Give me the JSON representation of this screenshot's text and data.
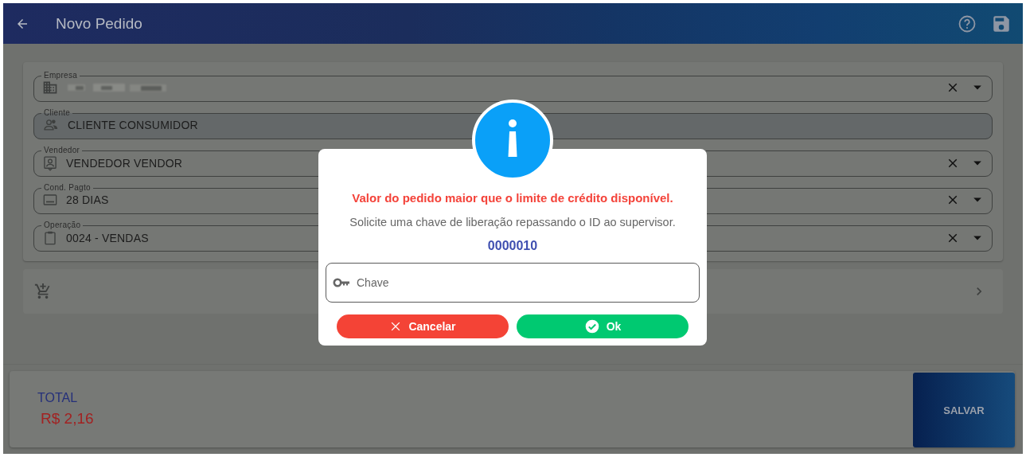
{
  "header": {
    "title": "Novo Pedido"
  },
  "fields": [
    {
      "label": "Empresa",
      "disabled": false
    },
    {
      "label": "Cliente",
      "value": "CLIENTE CONSUMIDOR",
      "disabled": true
    },
    {
      "label": "Vendedor",
      "value": "VENDEDOR VENDOR",
      "disabled": false
    },
    {
      "label": "Cond. Pagto",
      "value": "28 DIAS",
      "disabled": false
    },
    {
      "label": "Operação",
      "value": "0024 - VENDAS",
      "disabled": false
    }
  ],
  "footer": {
    "total_label": "TOTAL",
    "total_value": "R$ 2,16",
    "save_button": "SALVAR"
  },
  "dialog": {
    "title": "Valor do pedido maior que o limite de crédito disponível.",
    "message": "Solicite uma chave de liberação repassando o ID ao supervisor.",
    "id": "0000010",
    "input": {
      "placeholder": "Chave"
    },
    "buttons": [
      {
        "kind": "cancel",
        "label": "Cancelar"
      },
      {
        "kind": "confirm",
        "label": "Ok"
      }
    ]
  }
}
